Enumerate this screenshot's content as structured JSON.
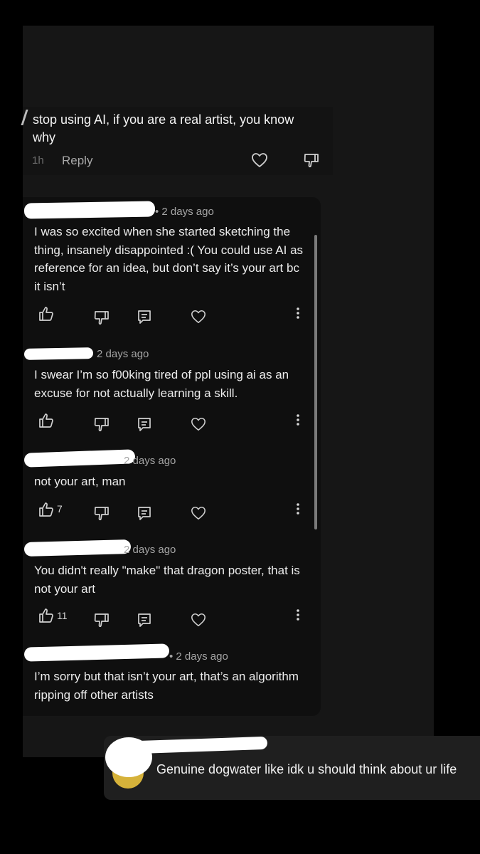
{
  "top_comment": {
    "text": "stop using AI, if you are a real artist, you know why",
    "time": "1h",
    "reply_label": "Reply"
  },
  "comments": [
    {
      "time": "• 2 days ago",
      "text": "I was so excited when she started sketching the thing, insanely disappointed :( You could use AI as reference for an idea, but don’t say it’s your art bc it isn’t",
      "likes": ""
    },
    {
      "time": "2 days ago",
      "text": "I swear I’m so f00king tired of ppl using ai as an excuse for not actually learning a skill.",
      "likes": ""
    },
    {
      "time": "2 days ago",
      "text": "not your art, man",
      "likes": "7"
    },
    {
      "time": "2 days ago",
      "text": "You didn't really \"make\" that dragon poster, that is not your art",
      "likes": "11"
    },
    {
      "time": "• 2 days ago",
      "text": "I’m sorry but that isn’t your art, that’s an algorithm ripping off other artists",
      "likes": ""
    }
  ],
  "reply": {
    "text": "Genuine dogwater like idk u should think about ur life"
  },
  "icons": {
    "like": "thumbs-up-icon",
    "dislike": "thumbs-down-icon",
    "reply": "reply-icon",
    "heart": "heart-icon",
    "more": "more-vertical-icon"
  }
}
